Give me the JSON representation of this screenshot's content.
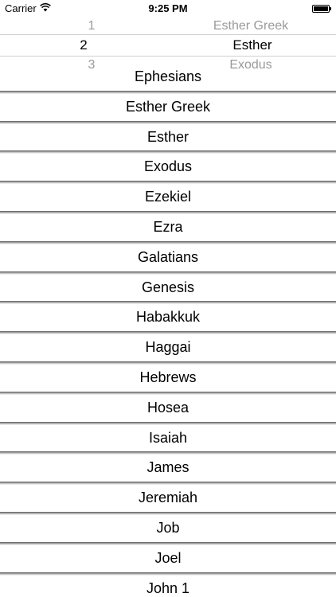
{
  "status_bar": {
    "carrier": "Carrier",
    "time": "9:25 PM",
    "wifi_icon": "wifi-icon",
    "battery_icon": "battery-icon"
  },
  "picker": {
    "numbers": [
      "1",
      "2",
      "3"
    ],
    "names": [
      "Esther Greek",
      "Esther",
      "Exodus"
    ],
    "selected_index": 1
  },
  "books": [
    "Ephesians",
    "Esther Greek",
    "Esther",
    "Exodus",
    "Ezekiel",
    "Ezra",
    "Galatians",
    "Genesis",
    "Habakkuk",
    "Haggai",
    "Hebrews",
    "Hosea",
    "Isaiah",
    "James",
    "Jeremiah",
    "Job",
    "Joel",
    "John 1"
  ]
}
